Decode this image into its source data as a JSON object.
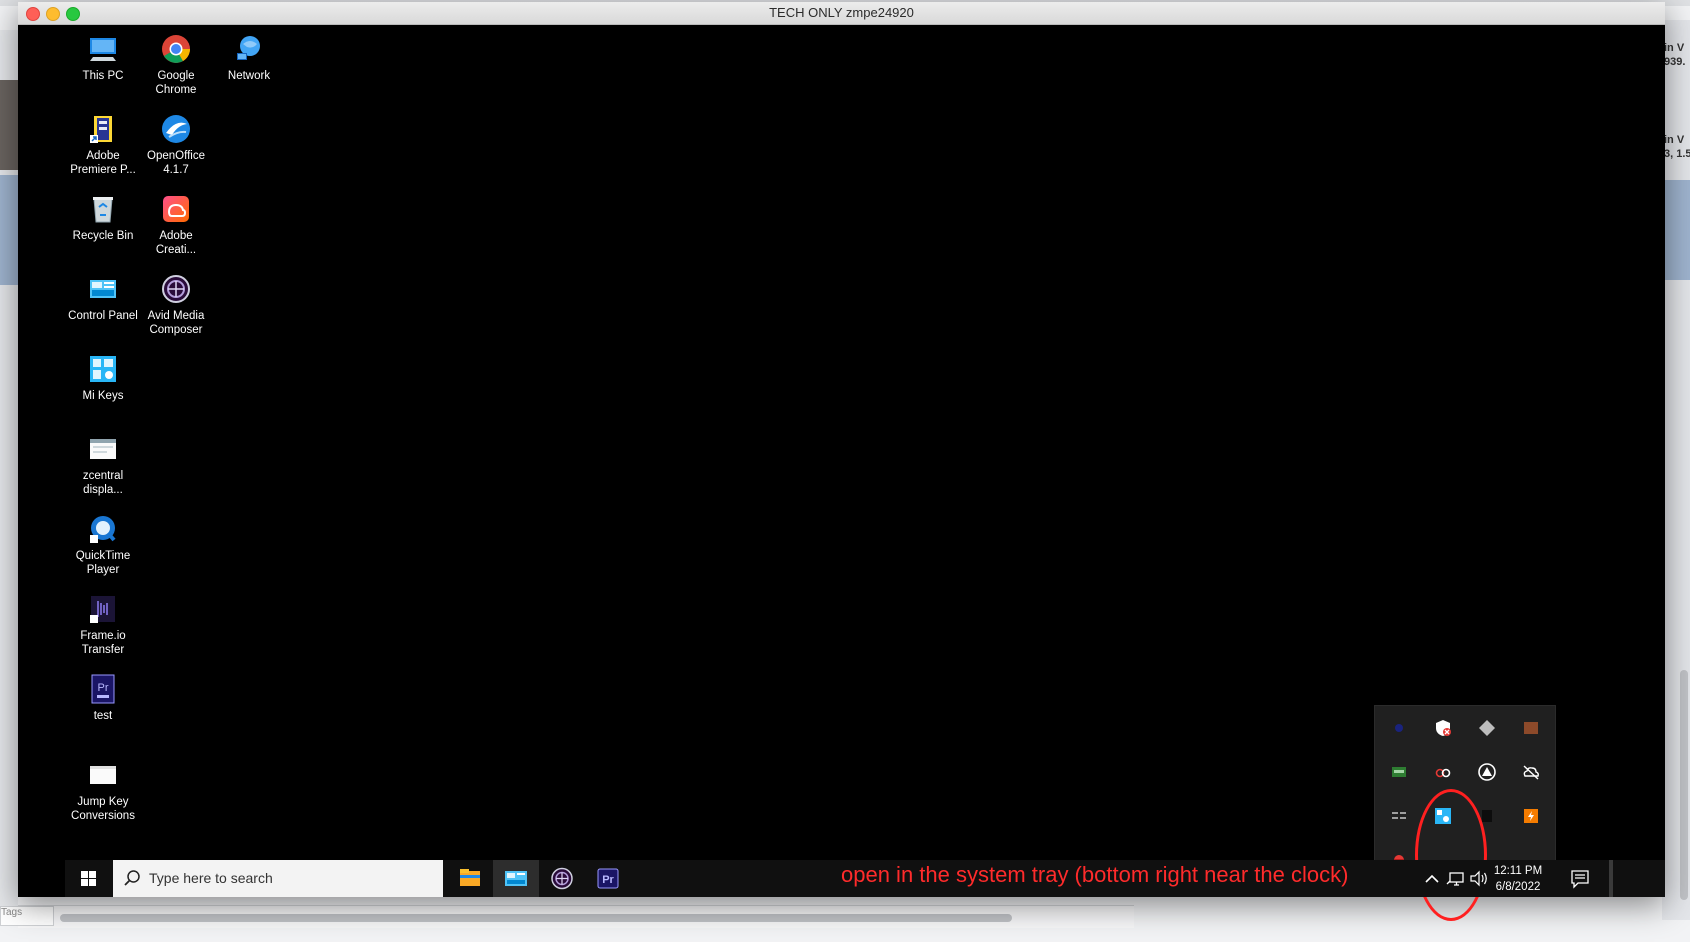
{
  "window": {
    "title": "TECH ONLY zmpe24920"
  },
  "desktop_icons": [
    {
      "id": "this-pc",
      "label": "This PC",
      "icon": "computer-icon"
    },
    {
      "id": "google-chrome",
      "label": "Google Chrome",
      "icon": "chrome-icon"
    },
    {
      "id": "network",
      "label": "Network",
      "icon": "network-icon"
    },
    {
      "id": "adobe-premiere",
      "label": "Adobe Premiere P...",
      "icon": "premiere-shortcut-icon"
    },
    {
      "id": "openoffice",
      "label": "OpenOffice 4.1.7",
      "icon": "openoffice-icon"
    },
    {
      "id": "recycle-bin",
      "label": "Recycle Bin",
      "icon": "recycle-bin-icon"
    },
    {
      "id": "adobe-creative",
      "label": "Adobe Creati...",
      "icon": "creative-cloud-icon"
    },
    {
      "id": "control-panel",
      "label": "Control Panel",
      "icon": "control-panel-icon"
    },
    {
      "id": "avid-media-composer",
      "label": "Avid Media Composer",
      "icon": "avid-icon"
    },
    {
      "id": "mi-keys",
      "label": "Mi Keys",
      "icon": "mi-keys-icon"
    },
    {
      "id": "zcentral",
      "label": "zcentral displa...",
      "icon": "zcentral-icon"
    },
    {
      "id": "quicktime",
      "label": "QuickTime Player",
      "icon": "quicktime-icon"
    },
    {
      "id": "frameio",
      "label": "Frame.io Transfer",
      "icon": "frameio-icon"
    },
    {
      "id": "test",
      "label": "test",
      "icon": "premiere-project-icon"
    },
    {
      "id": "jump-key",
      "label": "Jump Key Conversions",
      "icon": "document-icon"
    }
  ],
  "taskbar": {
    "search_placeholder": "Type here to search",
    "apps": [
      "file-explorer-icon",
      "control-panel-icon",
      "avid-icon",
      "premiere-icon"
    ],
    "clock_time": "12:11 PM",
    "clock_date": "6/8/2022",
    "premiere_glyph": "Pr"
  },
  "tray_icons": [
    "tray-blue-dot-icon",
    "tray-shield-icon",
    "tray-diamond-icon",
    "tray-brown-icon",
    "tray-green-icon",
    "tray-red-link-icon",
    "tray-up-arrow-icon",
    "tray-cloud-off-icon",
    "tray-keys-icon",
    "tray-mi-keys-icon",
    "tray-dark-icon",
    "tray-orange-icon",
    "tray-red-dot-icon"
  ],
  "annotation": {
    "text": "open in the system tray (bottom right near the clock)",
    "color": "#ff2b2b"
  },
  "background_app": {
    "right_edge_text_1": "in V",
    "right_edge_text_2": "939.",
    "right_edge_text_3": "in V",
    "right_edge_text_4": "3, 1.5",
    "tags_label": "Tags"
  }
}
